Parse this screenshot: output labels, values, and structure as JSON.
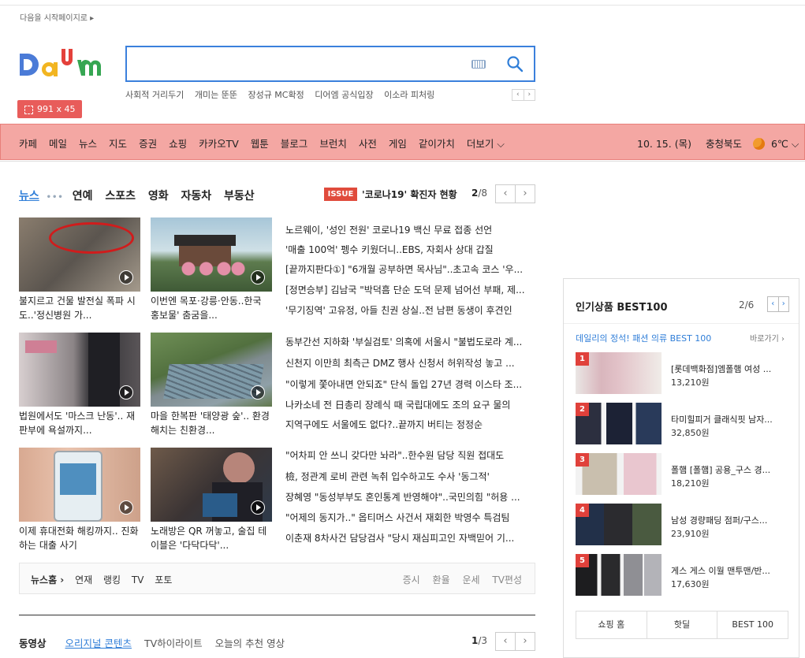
{
  "header": {
    "start_page_link": "다음을 시작페이지로 ▸",
    "search_placeholder": "",
    "keywords": [
      "사회적 거리두기",
      "개미는 뚠뚠",
      "장성규 MC확정",
      "디어엠 공식입장",
      "이소라 피처링"
    ],
    "kw_prev": "‹",
    "kw_next": "›",
    "size_badge": "991 x 45"
  },
  "gnb": {
    "items": [
      "카페",
      "메일",
      "뉴스",
      "지도",
      "증권",
      "쇼핑",
      "카카오TV",
      "웹툰",
      "블로그",
      "브런치",
      "사전",
      "게임",
      "같이가치",
      "더보기 ⌵"
    ],
    "date": "10. 15. (목)",
    "region": "충청북도",
    "temperature": "6℃ ⌵"
  },
  "news": {
    "tabs": [
      "뉴스",
      "연예",
      "스포츠",
      "영화",
      "자동차",
      "부동산"
    ],
    "dots": "•••",
    "issue_label": "ISSUE",
    "issue_text": "'코로나19' 확진자 현황",
    "page_current": "2",
    "page_total": "/8",
    "prev": "‹",
    "next": "›",
    "cards": [
      {
        "caption": "불지르고 건물 발전실 폭파 시도..'정신병원 가..."
      },
      {
        "caption": "이번엔 목포·강릉·안동..한국 홍보물' 춤굼을..."
      },
      {
        "caption": "법원에서도 '마스크 난동'.. 재판부에 욕설까지..."
      },
      {
        "caption": "마을 한복판 '태양광 숲'.. 환경 해치는 친환경..."
      },
      {
        "caption": "이제 휴대전화 해킹까지.. 진화하는 대출 사기"
      },
      {
        "caption": "노래방은 QR 꺼놓고, 술집 테이블은 '다닥다닥'..."
      }
    ],
    "headlines": [
      "노르웨이, '성인 전원' 코로나19 백신 무료 접종 선언",
      "'매출 100억' 펭수 키웠더니..EBS, 자회사 상대 갑질",
      "[끝까지판다①] \"6개월 공부하면 목사님\"..초고속 코스 '우...",
      "[정면승부] 김남국 \"박덕흠 단순 도덕 문제 넘어선 부패, 제...",
      "'무기징역' 고유정, 아들 친권 상실..전 남편 동생이 후견인",
      "동부간선 지하화 '부실검토' 의혹에 서울시 \"불법도로라 계...",
      "신천지 이만희 최측근 DMZ 행사 신청서 허위작성 놓고 ...",
      "\"이렇게 쫓아내면 안되죠\" 단식 돌입 27년 경력 이스타 조...",
      "나카소네 전 日총리 장례식 때 국립대에도 조의 요구 물의",
      "지역구에도 서울에도 없다?..끝까지 버티는 정정순",
      "\"어차피 안 쓰니 갖다만 놔라\"..한수원 담당 직원 접대도",
      "檢, 정관계 로비 관련 녹취 입수하고도 수사 '동그적'",
      "장혜영 \"동성부부도 혼인통계 반영해야\"..국민의힘 \"허용 ...",
      "\"어제의 동지가..\" 옵티머스 사건서 재회한 박영수 특검팀",
      "이춘재 8차사건 담당검사 \"당시 재심피고인 자백믿어 기..."
    ],
    "footer_left": [
      "뉴스홈 ›",
      "연재",
      "랭킹",
      "TV",
      "포토"
    ],
    "footer_right": [
      "증시",
      "환율",
      "운세",
      "TV편성"
    ]
  },
  "video": {
    "title": "동영상",
    "tabs": [
      "오리지널 콘텐츠",
      "TV하이라이트",
      "오늘의 추천 영상"
    ],
    "page_current": "1",
    "page_total": "/3",
    "prev": "‹",
    "next": "›"
  },
  "shop": {
    "title": "인기상품 BEST100",
    "page": "2/6",
    "prev": "‹",
    "next": "›",
    "subtitle": "데일리의 정석! 패션 의류 BEST 100",
    "more": "바로가기 ›",
    "products": [
      {
        "rank": "1",
        "name": "[롯데백화점]엠폴햄 여성 ...",
        "price": "13,210원"
      },
      {
        "rank": "2",
        "name": "타미힐피거 클래식핏 남자...",
        "price": "32,850원"
      },
      {
        "rank": "3",
        "name": "폴햄 [폴햄] 공용_구스 경...",
        "price": "18,210원"
      },
      {
        "rank": "4",
        "name": "남성 경량패딩 점퍼/구스...",
        "price": "23,910원"
      },
      {
        "rank": "5",
        "name": "게스 게스 이월 맨투맨/반...",
        "price": "17,630원"
      }
    ],
    "buttons": [
      "쇼핑 홈",
      "핫딜",
      "BEST 100"
    ]
  },
  "colors": {
    "accent": "#3b80dc",
    "issue": "#e04b3c",
    "highlight": "#f4a7a3"
  }
}
